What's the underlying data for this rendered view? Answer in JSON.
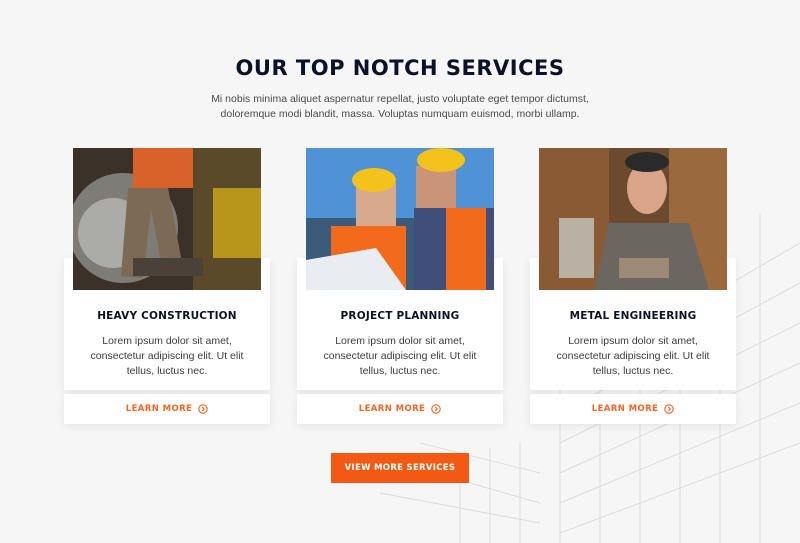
{
  "section": {
    "heading": "OUR TOP NOTCH SERVICES",
    "subtitle": "Mi nobis minima aliquet aspernatur repellat, justo voluptate eget tempor dictumst, doloremque modi blandit, massa. Voluptas numquam euismod, morbi ullamp."
  },
  "cards": [
    {
      "title": "HEAVY CONSTRUCTION",
      "text": "Lorem ipsum dolor sit amet, consectetur adipiscing elit. Ut elit tellus, luctus nec.",
      "link_label": "LEARN MORE"
    },
    {
      "title": "PROJECT PLANNING",
      "text": "Lorem ipsum dolor sit amet, consectetur adipiscing elit. Ut elit tellus, luctus nec.",
      "link_label": "LEARN MORE"
    },
    {
      "title": "METAL ENGINEERING",
      "text": "Lorem ipsum dolor sit amet, consectetur adipiscing elit. Ut elit tellus, luctus nec.",
      "link_label": "LEARN MORE"
    }
  ],
  "cta": {
    "label": "VIEW MORE SERVICES"
  },
  "colors": {
    "accent": "#f25a14",
    "heading": "#0d1127",
    "background": "#f6f6f6"
  },
  "icons": {
    "link_arrow": "arrow-circle-right-icon"
  }
}
